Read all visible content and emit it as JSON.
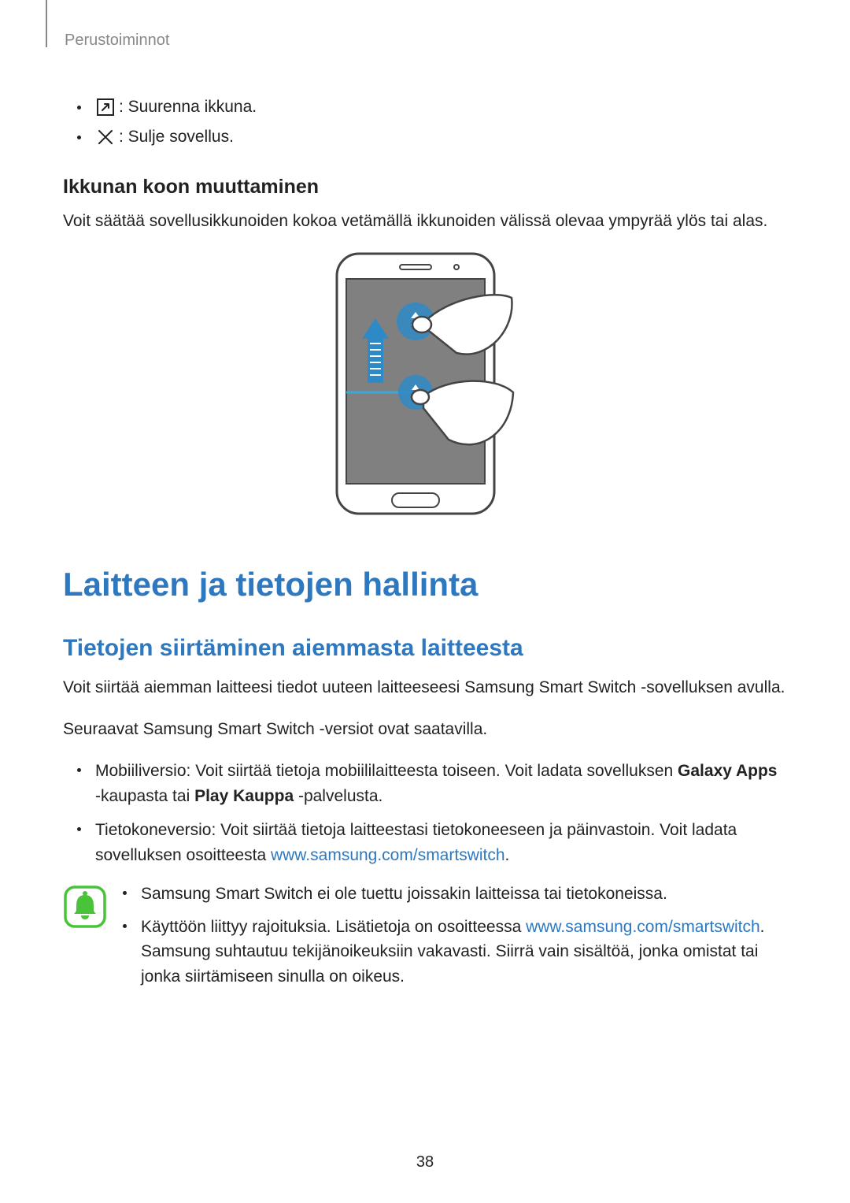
{
  "header": "Perustoiminnot",
  "bullets": [
    {
      "icon": "expand",
      "text": ": Suurenna ikkuna."
    },
    {
      "icon": "close",
      "text": ": Sulje sovellus."
    }
  ],
  "resize_heading": "Ikkunan koon muuttaminen",
  "resize_body": "Voit säätää sovellusikkunoiden kokoa vetämällä ikkunoiden välissä olevaa ympyrää ylös tai alas.",
  "h1": "Laitteen ja tietojen hallinta",
  "h2": "Tietojen siirtäminen aiemmasta laitteesta",
  "transfer_body1": "Voit siirtää aiemman laitteesi tiedot uuteen laitteeseesi Samsung Smart Switch -sovelluksen avulla.",
  "transfer_body2": "Seuraavat Samsung Smart Switch -versiot ovat saatavilla.",
  "version_items": [
    {
      "prefix": "Mobiiliversio: Voit siirtää tietoja mobiililaitteesta toiseen. Voit ladata sovelluksen ",
      "bold1": "Galaxy Apps",
      "mid": " -kaupasta tai ",
      "bold2": "Play Kauppa",
      "suffix": " -palvelusta."
    },
    {
      "prefix": "Tietokoneversio: Voit siirtää tietoja laitteestasi tietokoneeseen ja päinvastoin. Voit ladata sovelluksen osoitteesta ",
      "link": "www.samsung.com/smartswitch",
      "suffix": "."
    }
  ],
  "note_items": [
    {
      "text": "Samsung Smart Switch ei ole tuettu joissakin laitteissa tai tietokoneissa."
    },
    {
      "prefix": "Käyttöön liittyy rajoituksia. Lisätietoja on osoitteessa ",
      "link": "www.samsung.com/smartswitch",
      "suffix": ". Samsung suhtautuu tekijänoikeuksiin vakavasti. Siirrä vain sisältöä, jonka omistat tai jonka siirtämiseen sinulla on oikeus."
    }
  ],
  "page_number": "38"
}
